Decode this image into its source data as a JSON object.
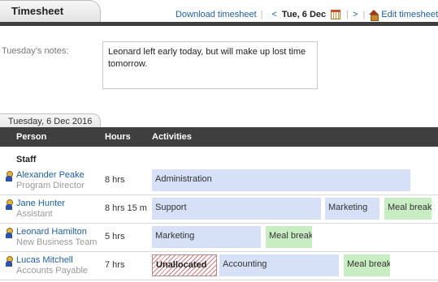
{
  "header": {
    "title": "Timesheet",
    "download_label": "Download timesheet",
    "prev_label": "<",
    "current_date": "Tue, 6 Dec",
    "next_label": ">",
    "edit_label": "Edit timesheet"
  },
  "notes": {
    "label": "Tuesday's notes:",
    "text": "Leonard left early today, but will make up lost time tomorrow."
  },
  "day_tab": "Tuesday, 6 Dec 2016",
  "table": {
    "columns": [
      "Person",
      "Hours",
      "Activities"
    ],
    "section": "Staff",
    "rows": [
      {
        "name": "Alexander Peake",
        "role": "Program Director",
        "hours": "8 hrs",
        "activities": [
          {
            "label": "Administration",
            "type": "blue"
          }
        ]
      },
      {
        "name": "Jane Hunter",
        "role": "Assistant",
        "hours": "8 hrs 15 m",
        "activities": [
          {
            "label": "Support",
            "type": "blue"
          },
          {
            "label": "Marketing",
            "type": "blue"
          },
          {
            "label": "Meal break",
            "type": "green"
          }
        ]
      },
      {
        "name": "Leonard Hamilton",
        "role": "New Business Team",
        "hours": "5 hrs",
        "activities": [
          {
            "label": "Marketing",
            "type": "blue"
          },
          {
            "label": "Meal break",
            "type": "green"
          }
        ]
      },
      {
        "name": "Lucas Mitchell",
        "role": "Accounts Payable",
        "hours": "7 hrs",
        "activities": [
          {
            "label": "Unallocated",
            "type": "unalloc"
          },
          {
            "label": "Accounting",
            "type": "blue"
          },
          {
            "label": "Meal break",
            "type": "green"
          }
        ]
      }
    ]
  },
  "colors": {
    "activity_blue": "#d6e1f7",
    "activity_green": "#c9edc2",
    "header_bar": "#3f3f3f",
    "link": "#1f5f9e"
  },
  "icons": [
    "calendar-icon",
    "home-icon",
    "person-icon"
  ]
}
